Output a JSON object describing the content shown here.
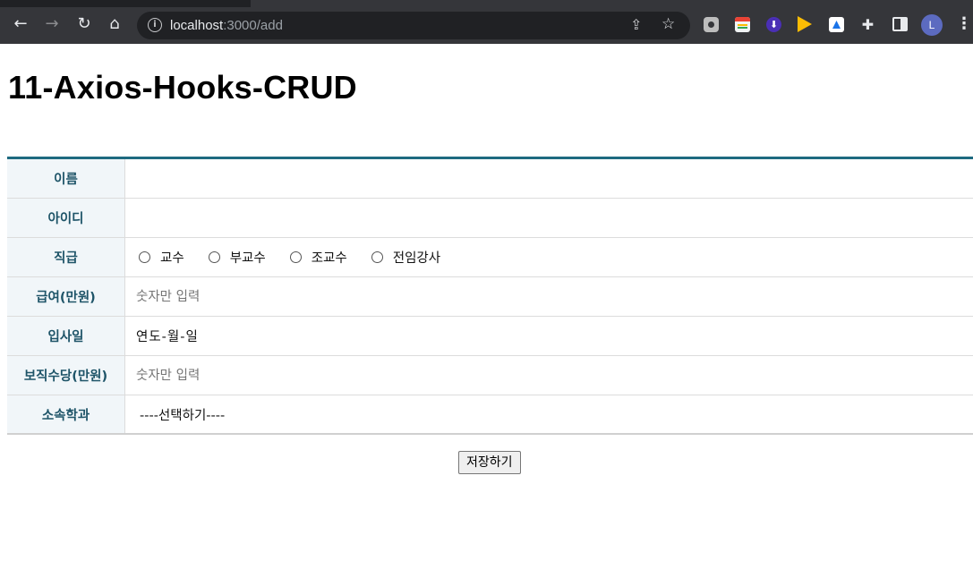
{
  "browser": {
    "url_host": "localhost",
    "url_path": ":3000/add",
    "avatar_letter": "L",
    "icons": [
      "back-arrow-icon",
      "forward-arrow-icon",
      "reload-icon",
      "home-icon",
      "info-icon",
      "share-icon",
      "star-icon",
      "camera-extension-icon",
      "calendar-extension-icon",
      "download-extension-icon",
      "play-extension-icon",
      "doc-extension-icon",
      "puzzle-icon",
      "side-panel-icon",
      "kebab-menu-icon"
    ]
  },
  "page": {
    "title": "11-Axios-Hooks-CRUD"
  },
  "form": {
    "name_label": "이름",
    "id_label": "아이디",
    "position_label": "직급",
    "position_options": [
      "교수",
      "부교수",
      "조교수",
      "전임강사"
    ],
    "salary_label": "급여(만원)",
    "salary_placeholder": "숫자만 입력",
    "hiredate_label": "입사일",
    "hiredate_value": "연도-월-일",
    "allowance_label": "보직수당(만원)",
    "allowance_placeholder": "숫자만 입력",
    "dept_label": "소속학과",
    "dept_selected": "----선택하기----",
    "save_label": "저장하기"
  },
  "colors": {
    "accent_border": "#1e6a80",
    "label_text": "#1e5468",
    "label_bg": "#f1f6f9"
  }
}
